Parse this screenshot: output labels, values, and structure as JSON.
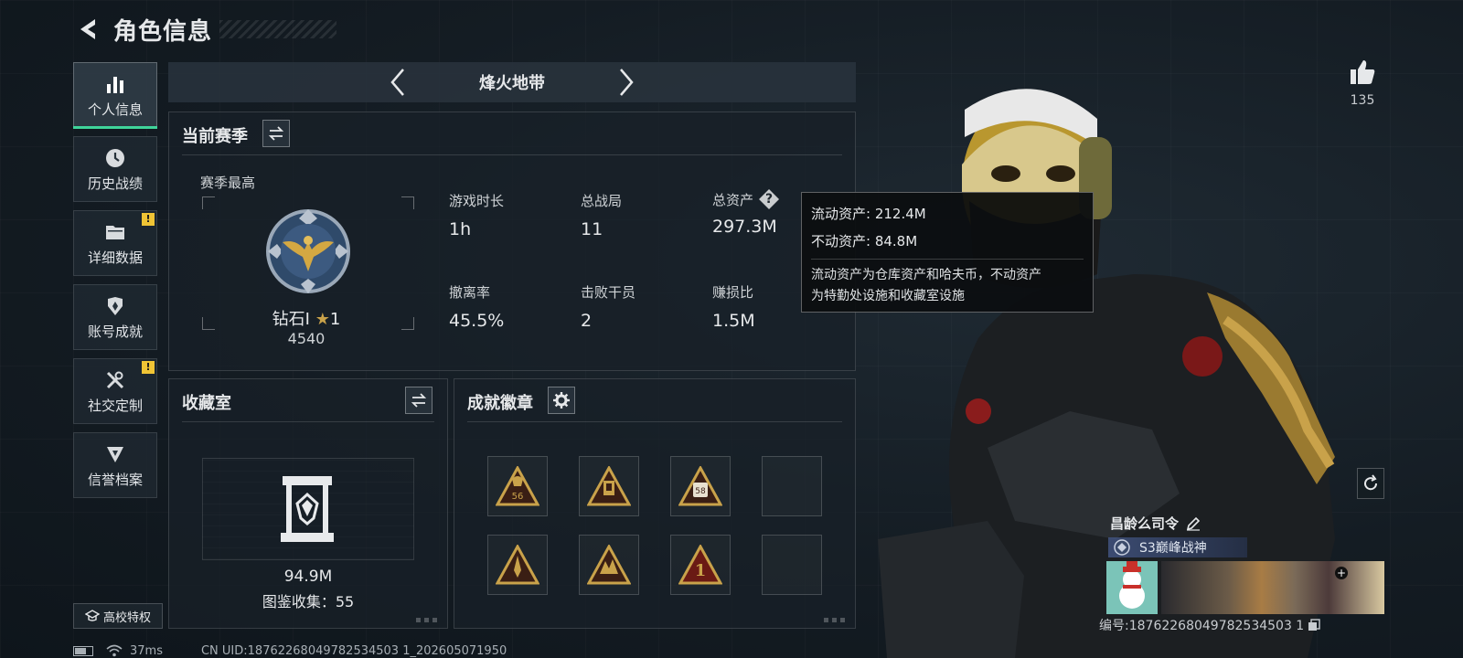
{
  "header": {
    "title": "角色信息"
  },
  "sidebar": {
    "items": [
      {
        "label": "个人信息",
        "icon": "bar-chart-icon",
        "active": true
      },
      {
        "label": "历史战绩",
        "icon": "history-icon"
      },
      {
        "label": "详细数据",
        "icon": "folder-icon",
        "alert": "!"
      },
      {
        "label": "账号成就",
        "icon": "achievement-icon"
      },
      {
        "label": "社交定制",
        "icon": "tools-icon",
        "alert": "!"
      },
      {
        "label": "信誉档案",
        "icon": "reputation-icon"
      }
    ],
    "campus_label": "高校特权"
  },
  "status": {
    "ping": "37ms",
    "uid": "CN UID:18762268049782534503 1_202605071950"
  },
  "season": {
    "name": "烽火地带"
  },
  "current_season": {
    "title": "当前赛季",
    "best_label": "赛季最高",
    "rank_name": "钻石I",
    "rank_stars": "1",
    "rank_score": "4540",
    "stats": [
      {
        "label": "游戏时长",
        "value": "1h"
      },
      {
        "label": "总战局",
        "value": "11"
      },
      {
        "label": "总资产",
        "value": "297.3M"
      },
      {
        "label": "撤离率",
        "value": "45.5%"
      },
      {
        "label": "击败干员",
        "value": "2"
      },
      {
        "label": "赚损比",
        "value": "1.5M"
      }
    ]
  },
  "tooltip": {
    "liquid": "流动资产: 212.4M",
    "fixed": "不动资产: 84.8M",
    "desc_1": "流动资产为仓库资产和哈夫币，不动资产",
    "desc_2": "为特勤处设施和收藏室设施"
  },
  "collection": {
    "title": "收藏室",
    "value": "94.9M",
    "count": "图鉴收集：55"
  },
  "achievements": {
    "title": "成就徽章",
    "badges": [
      "56",
      "",
      "58",
      "",
      "",
      "",
      "1",
      ""
    ]
  },
  "player": {
    "likes": "135",
    "name": "昌龄么司令",
    "title": "S3巅峰战神",
    "id": "编号:18762268049782534503 1"
  },
  "colors": {
    "accent": "#3fd49a",
    "alert": "#f0c435",
    "gold": "#c9a24a"
  }
}
